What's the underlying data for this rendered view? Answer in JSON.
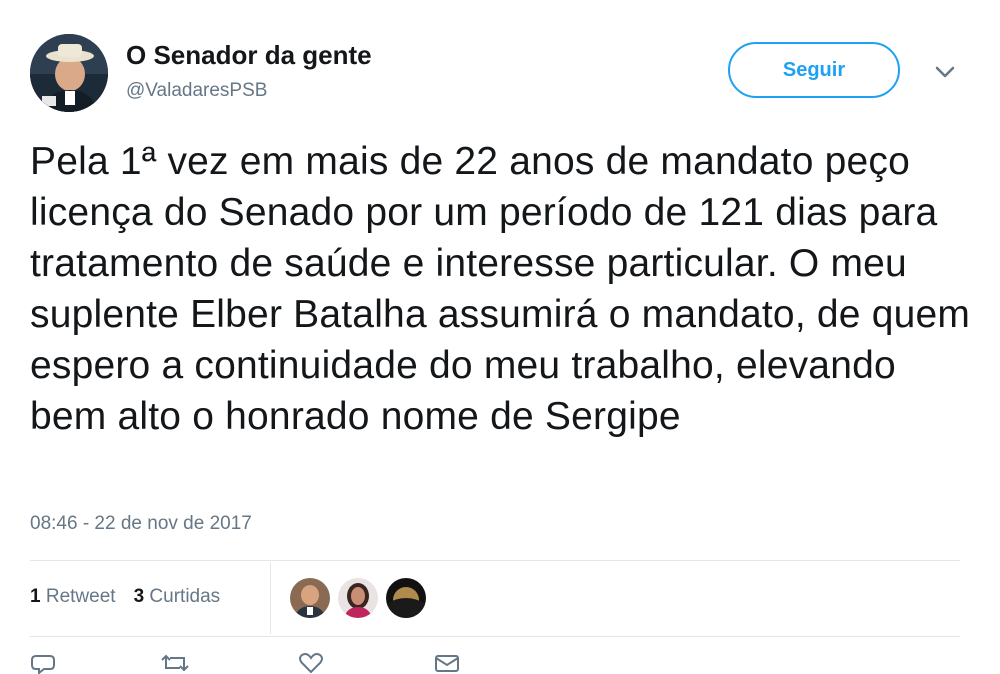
{
  "tweet": {
    "author_name": "O Senador da gente",
    "author_handle": "@ValadaresPSB",
    "follow_label": "Seguir",
    "text": "Pela 1ª vez em mais de 22 anos de mandato peço licença do Senado por um período de 121 dias para tratamento de saúde e interesse particular. O meu suplente Elber Batalha assumirá o mandato, de quem espero a continuidade do meu trabalho, elevando bem alto o honrado nome de Sergipe",
    "timestamp": "08:46 - 22 de nov de 2017"
  },
  "stats": {
    "retweets_count": "1",
    "retweets_label": "Retweet",
    "likes_count": "3",
    "likes_label": "Curtidas"
  },
  "icons": {
    "caret": "chevron-down-icon",
    "reply": "reply-icon",
    "retweet": "retweet-icon",
    "like": "heart-icon",
    "message": "message-icon"
  },
  "colors": {
    "accent": "#1da1f2",
    "text": "#14171a",
    "secondary": "#657786",
    "divider": "#e1e8ed"
  }
}
